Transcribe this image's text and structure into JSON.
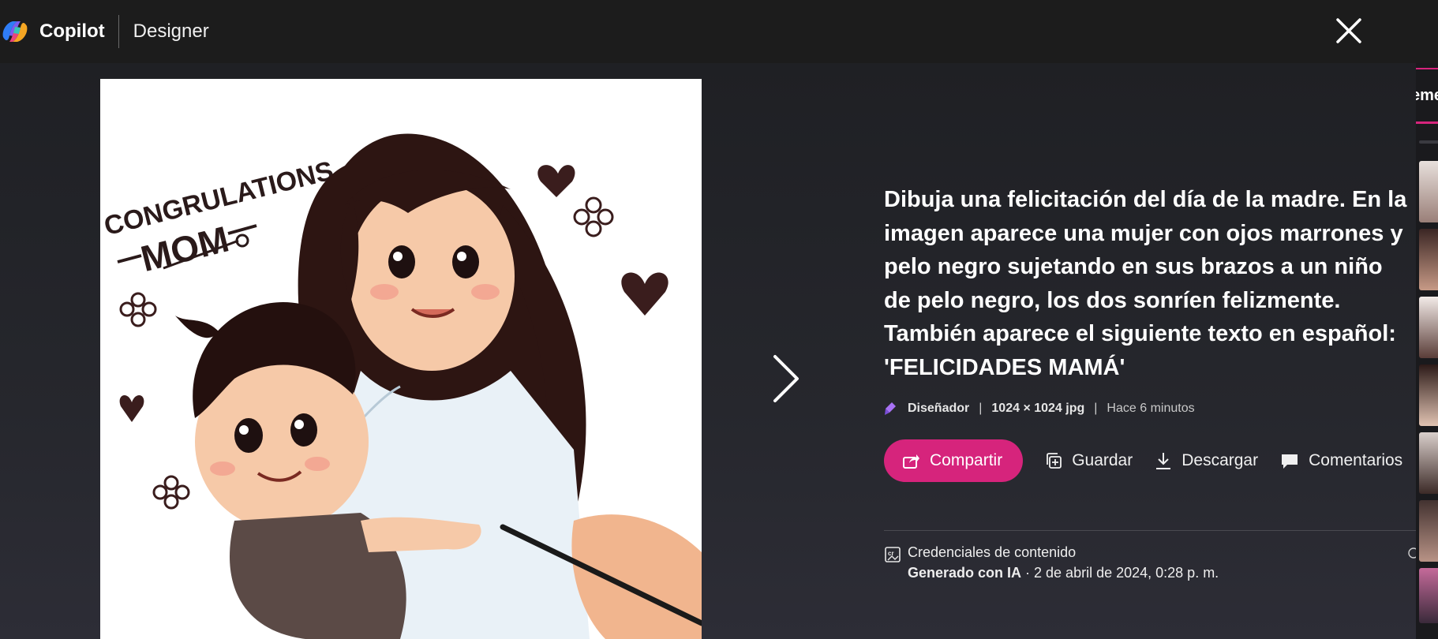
{
  "header": {
    "app_name": "Copilot",
    "app_section": "Designer"
  },
  "image": {
    "illustration_text_line1": "CONGRULATIONS",
    "illustration_text_line2": "MOM"
  },
  "details": {
    "prompt": "Dibuja una felicitación del día de la madre. En la imagen aparece una mujer con ojos marrones y pelo negro sujetando en sus brazos a un niño de pelo negro, los dos sonríen felizmente. También aparece el siguiente texto en español: 'FELICIDADES MAMÁ'",
    "meta": {
      "creator": "Diseñador",
      "size": "1024 × 1024 jpg",
      "time": "Hace 6 minutos",
      "separator": "|"
    },
    "actions": {
      "share": "Compartir",
      "save": "Guardar",
      "download": "Descargar",
      "comments": "Comentarios"
    },
    "credentials": {
      "title": "Credenciales de contenido",
      "generated": "Generado con IA",
      "date": " · 2 de abril de 2024, 0:28 p. m."
    }
  },
  "sidebar": {
    "tab_label": "eme"
  },
  "colors": {
    "accent": "#d6247c",
    "background": "#232428",
    "topbar": "#1c1c1c"
  },
  "icons": [
    "copilot-logo-icon",
    "close-icon",
    "chevron-right-icon",
    "designer-icon",
    "share-icon",
    "save-icon",
    "download-icon",
    "comment-icon",
    "content-credentials-icon"
  ]
}
